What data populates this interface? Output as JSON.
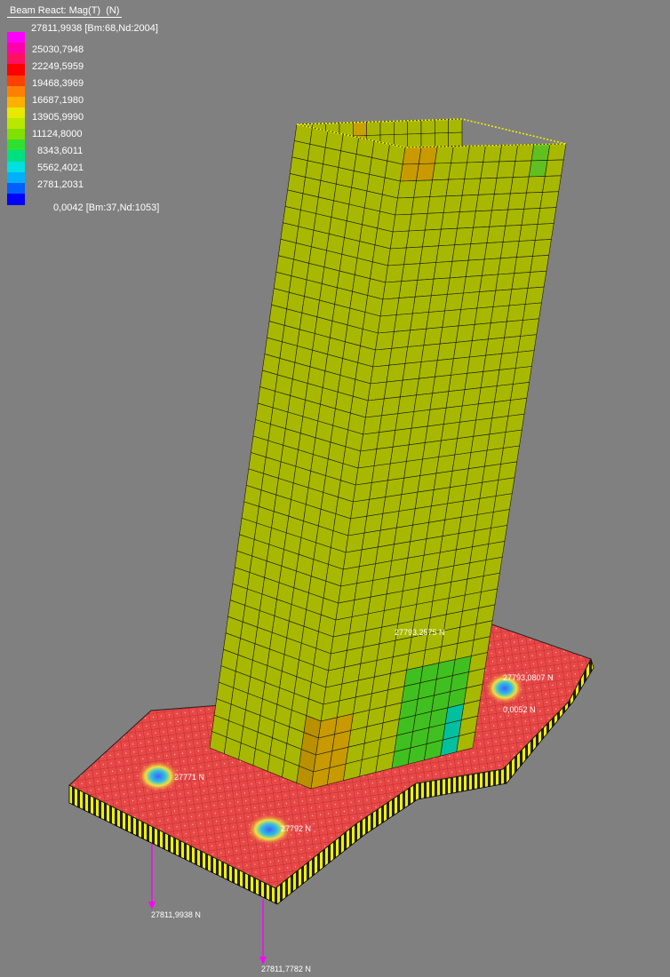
{
  "legend": {
    "title": "Beam React: Mag(T)  (N)",
    "max_label": "27811,9938 [Bm:68,Nd:2004]",
    "min_label": "0,0042 [Bm:37,Nd:1053]",
    "values": [
      "25030,7948",
      "22249,5959",
      "19468,3969",
      "16687,1980",
      "13905,9990",
      "11124,8000",
      "8343,6011",
      "5562,4021",
      "2781,2031"
    ],
    "colors": [
      "#ff00ff",
      "#ff00aa",
      "#ff1060",
      "#ff0000",
      "#ff4000",
      "#ff8000",
      "#ffb000",
      "#e8e800",
      "#b8e800",
      "#80e000",
      "#30e030",
      "#00e080",
      "#00e0e0",
      "#00b0ff",
      "#0060ff",
      "#0000ff"
    ]
  },
  "model": {
    "tower_color": "#a8b800",
    "plate_color": "#e84848",
    "annotations": {
      "tower_center": "27793,2575 N",
      "right_hole_top": "27793,0807 N",
      "right_hole_bottom": "0,0052 N",
      "left_hole": "27771 N",
      "center_hole": "27792 N",
      "reaction_1": "27811,9938 N",
      "reaction_2": "27811,7782 N"
    }
  }
}
